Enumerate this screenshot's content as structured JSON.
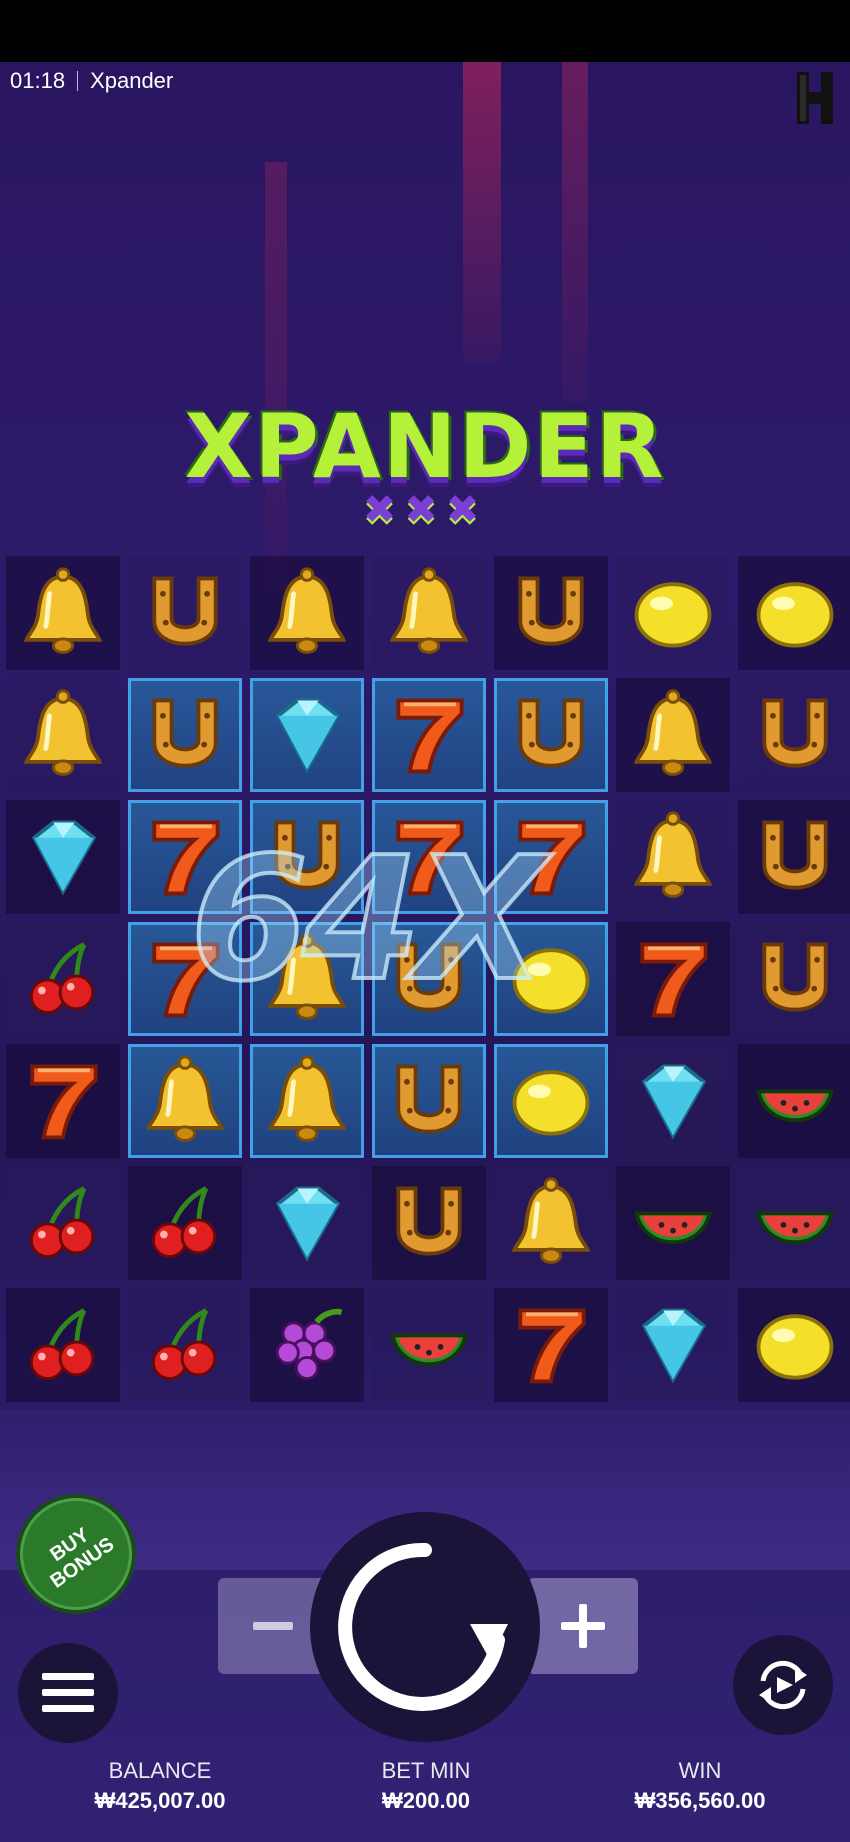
{
  "status": {
    "time": "01:18",
    "game_title": "Xpander"
  },
  "logo": {
    "title": "XPANDER"
  },
  "multiplier": "64X",
  "grid": {
    "rows": [
      [
        "bell",
        "horseshoe",
        "bell",
        "bell",
        "horseshoe",
        "lemon",
        "lemon"
      ],
      [
        "bell",
        "horseshoe",
        "diamond",
        "seven",
        "horseshoe",
        "bell",
        "horseshoe"
      ],
      [
        "diamond",
        "seven",
        "horseshoe",
        "seven",
        "seven",
        "bell",
        "horseshoe"
      ],
      [
        "cherry",
        "seven",
        "bell",
        "horseshoe",
        "lemon",
        "seven",
        "horseshoe"
      ],
      [
        "seven",
        "bell",
        "bell",
        "horseshoe",
        "lemon",
        "diamond",
        "watermelon"
      ],
      [
        "cherry",
        "cherry",
        "diamond",
        "horseshoe",
        "bell",
        "watermelon",
        "watermelon"
      ],
      [
        "cherry",
        "cherry",
        "grape",
        "watermelon",
        "seven",
        "diamond",
        "lemon"
      ]
    ],
    "highlighted": [
      [
        1,
        1
      ],
      [
        1,
        2
      ],
      [
        1,
        3
      ],
      [
        1,
        4
      ],
      [
        2,
        1
      ],
      [
        2,
        2
      ],
      [
        2,
        3
      ],
      [
        2,
        4
      ],
      [
        3,
        1
      ],
      [
        3,
        2
      ],
      [
        3,
        3
      ],
      [
        3,
        4
      ],
      [
        4,
        1
      ],
      [
        4,
        2
      ],
      [
        4,
        3
      ],
      [
        4,
        4
      ]
    ]
  },
  "controls": {
    "buy_bonus_label": "BUY\nBONUS",
    "minus_icon": "minus-icon",
    "plus_icon": "plus-icon",
    "spin_icon": "spin-icon",
    "menu_icon": "hamburger-menu-icon",
    "autoplay_icon": "autoplay-icon"
  },
  "stats": {
    "balance_label": "BALANCE",
    "balance_value": "₩425,007.00",
    "bet_label": "BET MIN",
    "bet_value": "₩200.00",
    "win_label": "WIN",
    "win_value": "₩356,560.00"
  },
  "colors": {
    "accent_green": "#b6f13a",
    "purple": "#7b3fd6",
    "highlight_blue": "#46aaf0",
    "buy_bonus": "#2b7a2a"
  }
}
